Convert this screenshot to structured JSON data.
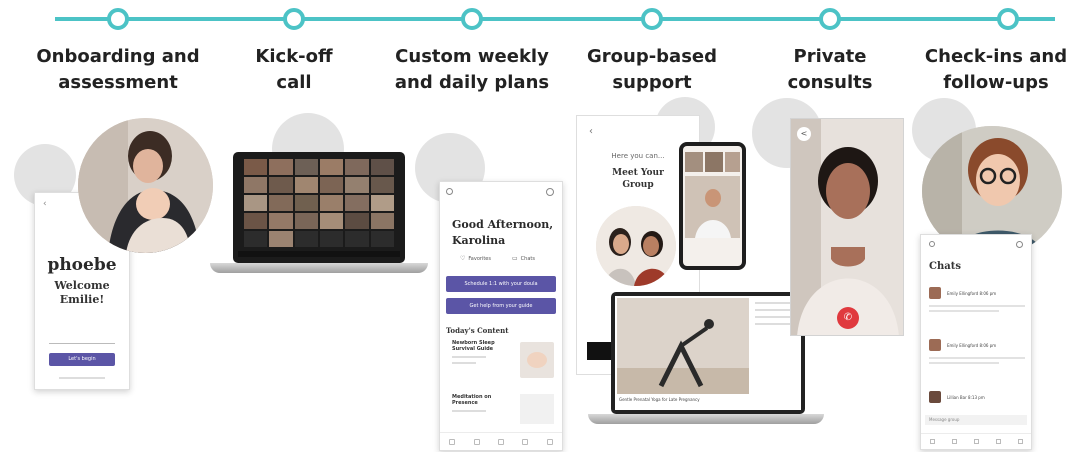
{
  "timeline": {
    "steps": [
      {
        "line1": "Onboarding and",
        "line2": "assessment"
      },
      {
        "line1": "Kick-off",
        "line2": "call"
      },
      {
        "line1": "Custom weekly",
        "line2": "and daily plans"
      },
      {
        "line1": "Group-based",
        "line2": "support"
      },
      {
        "line1": "Private",
        "line2": "consults"
      },
      {
        "line1": "Check-ins and",
        "line2": "follow-ups"
      }
    ]
  },
  "onboarding_screen": {
    "logo": "phoebe",
    "welcome": "Welcome",
    "name": "Emilie!",
    "button": "Let's begin"
  },
  "plans_screen": {
    "greeting": "Good Afternoon,",
    "name": "Karolina",
    "favorites": "Favorites",
    "chats": "Chats",
    "btn1": "Schedule 1:1 with your doula",
    "btn2": "Get help from your guide",
    "section": "Today's Content",
    "item1": "Newborn Sleep Survival Guide",
    "item2": "Meditation on Presence"
  },
  "group_screen": {
    "intro": "Here you can...",
    "title_line1": "Meet Your",
    "title_line2": "Group"
  },
  "video_laptop": {
    "caption": "Gentle Prenatal Yoga for Late Pregnancy"
  },
  "chats_screen": {
    "title": "Chats",
    "entries": [
      {
        "name": "Emily Ellingford 8:06 pm"
      },
      {
        "name": "Emily Ellingford 8:06 pm"
      },
      {
        "name": "Lillian Bar 8:13 pm"
      }
    ],
    "input_placeholder": "Message group"
  },
  "colors": {
    "teal": "#4cc3c6",
    "purple": "#5b55a6",
    "end_call_red": "#e0393e"
  }
}
